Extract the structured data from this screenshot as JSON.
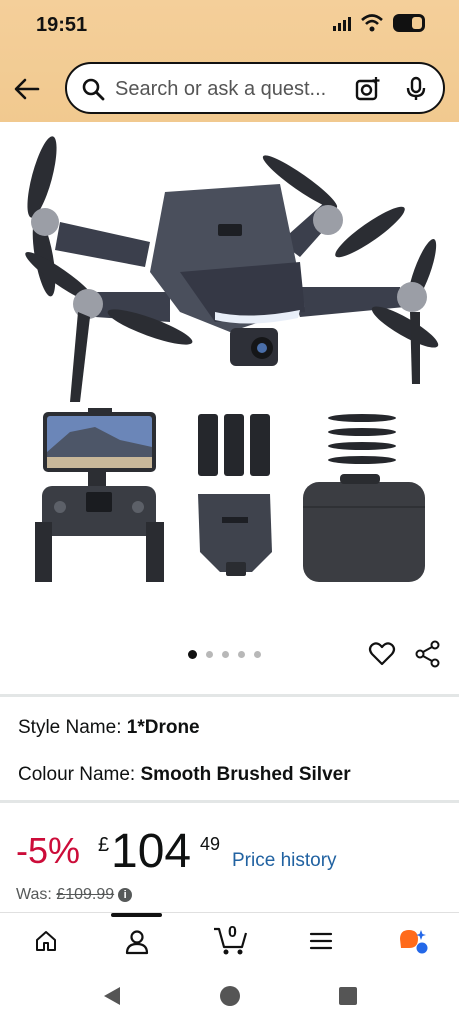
{
  "status_bar": {
    "time": "19:51"
  },
  "search": {
    "placeholder": "Search or ask a quest..."
  },
  "gallery": {
    "dot_count": 5,
    "active_dot": 0
  },
  "variants": {
    "style_label": "Style Name:",
    "style_value": "1*Drone",
    "colour_label": "Colour Name:",
    "colour_value": "Smooth Brushed Silver"
  },
  "price": {
    "discount": "-5%",
    "currency": "£",
    "whole": "104",
    "fraction": "49",
    "history_link": "Price history",
    "was_label": "Was:",
    "was_value": "£109.99"
  },
  "bottom_nav": {
    "items": [
      "home-icon",
      "account-icon",
      "cart-icon",
      "menu-icon",
      "rufus-icon"
    ],
    "cart_count": "0",
    "selected": "account-icon"
  },
  "colors": {
    "header": "#f3cd96",
    "discount": "#cc0c39",
    "link": "#2162a1"
  }
}
